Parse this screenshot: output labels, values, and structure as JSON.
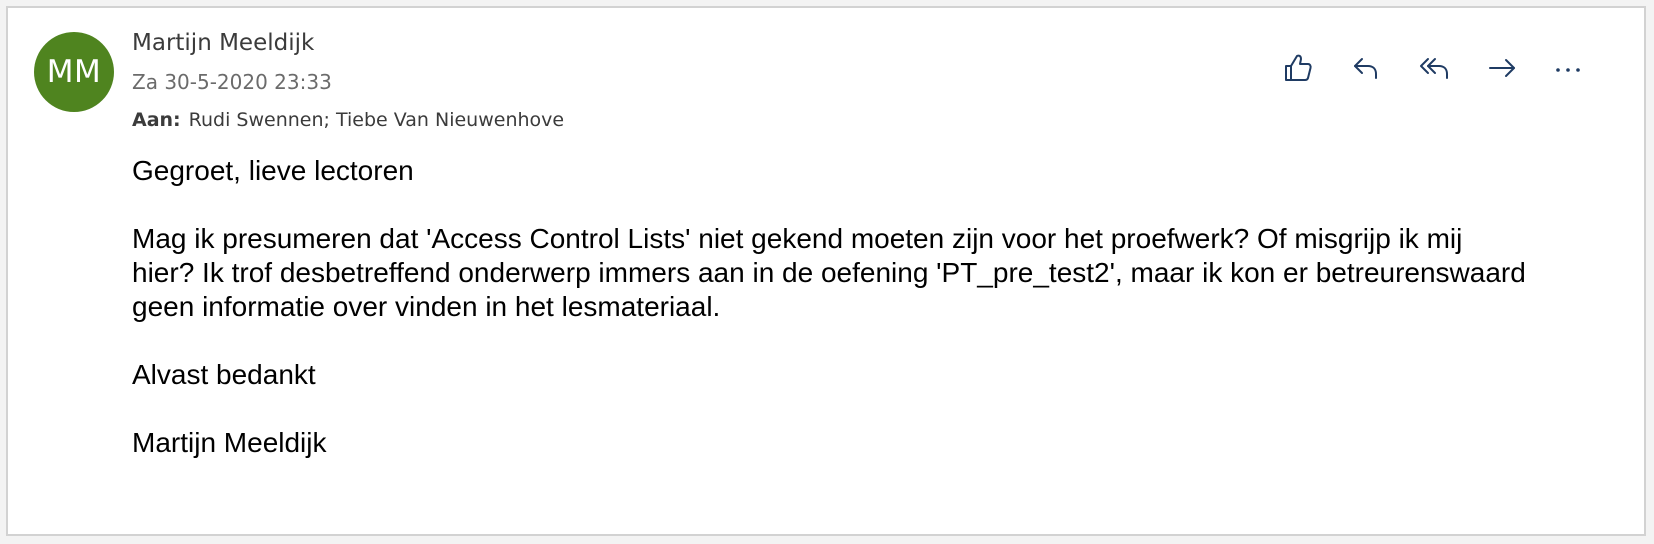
{
  "message": {
    "avatar_initials": "MM",
    "avatar_color": "#4f841f",
    "sender_name": "Martijn Meeldijk",
    "date": "Za 30-5-2020 23:33",
    "recipients_label": "Aan:",
    "recipients": "Rudi Swennen; Tiebe Van Nieuwenhove"
  },
  "actions": [
    {
      "name": "like",
      "icon": "thumbs-up-icon"
    },
    {
      "name": "reply",
      "icon": "reply-icon"
    },
    {
      "name": "reply-all",
      "icon": "reply-all-icon"
    },
    {
      "name": "forward",
      "icon": "forward-icon"
    },
    {
      "name": "more",
      "icon": "more-icon"
    }
  ],
  "body": {
    "greeting": "Gegroet, lieve lectoren",
    "paragraph": "Mag ik presumeren dat 'Access Control Lists' niet gekend moeten zijn voor het proefwerk? Of misgrijp ik mij hier? Ik trof desbetreffend onderwerp immers aan in de oefening 'PT_pre_test2', maar ik kon er betreurenswaard geen informatie over vinden in het lesmateriaal.",
    "closing": "Alvast bedankt",
    "signature": "Martijn Meeldijk"
  },
  "colors": {
    "icon_stroke": "#1f3b63",
    "card_border": "#d2d2d2"
  }
}
